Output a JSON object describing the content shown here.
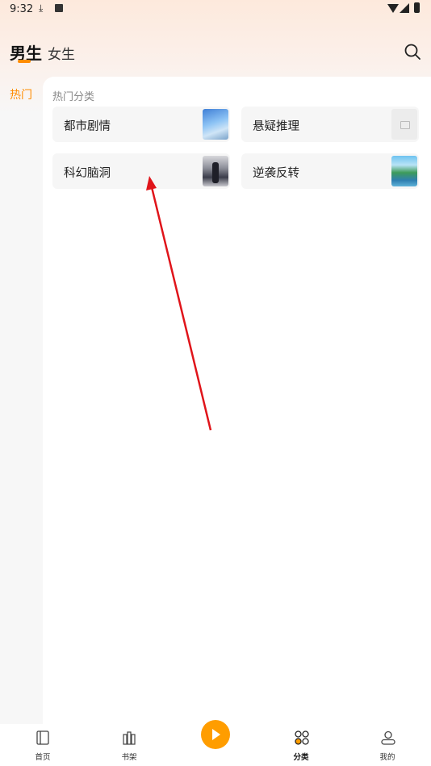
{
  "status_bar": {
    "time": "9:32"
  },
  "header": {
    "tabs": [
      "男生",
      "女生"
    ],
    "active_tab": "男生"
  },
  "sidebar": {
    "items": [
      "热门"
    ],
    "active": "热门"
  },
  "section": {
    "title": "热门分类",
    "categories": [
      {
        "label": "都市剧情",
        "thumb": "sky-illustration"
      },
      {
        "label": "悬疑推理",
        "thumb": "placeholder-image"
      },
      {
        "label": "科幻脑洞",
        "thumb": "city-illustration"
      },
      {
        "label": "逆袭反转",
        "thumb": "lake-illustration"
      }
    ]
  },
  "bottom_nav": {
    "items": [
      "首页",
      "书架",
      "分类",
      "我的"
    ],
    "active": "分类"
  },
  "colors": {
    "accent": "#ff8c00",
    "play": "#ff9d00",
    "annotation_arrow": "#e0141a"
  }
}
